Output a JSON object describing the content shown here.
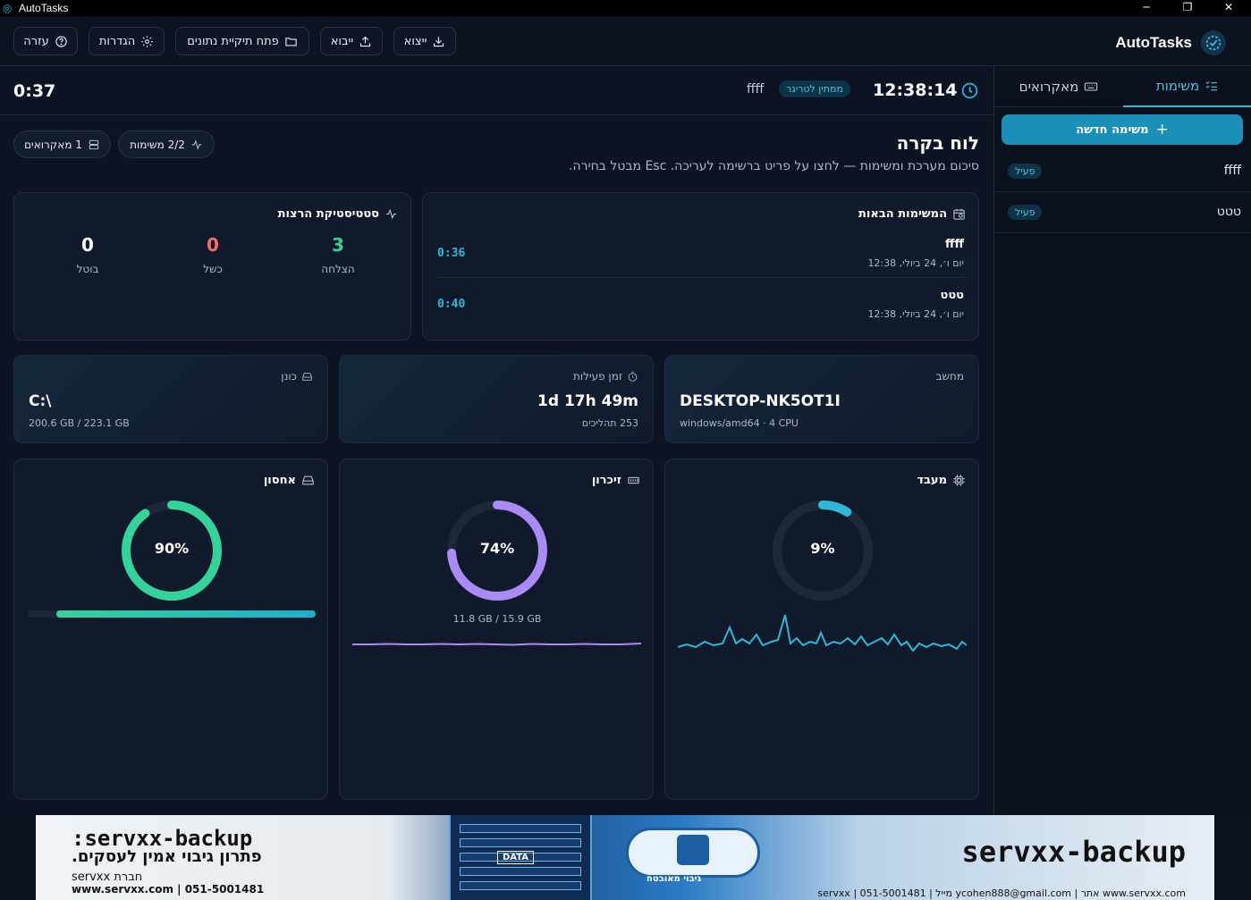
{
  "window": {
    "title": "AutoTasks",
    "minimize": "─",
    "maximize": "❐",
    "close": "✕"
  },
  "toolbar": {
    "help": "עזרה",
    "settings": "הגדרות",
    "open_folder": "פתח תיקיית נתונים",
    "import": "ייבוא",
    "export": "ייצוא",
    "brand": "AutoTasks"
  },
  "sidebar": {
    "tabs": [
      {
        "label": "משימות",
        "icon": "list-check-icon",
        "active": true
      },
      {
        "label": "מאקרואים",
        "icon": "keyboard-icon",
        "active": false
      }
    ],
    "new_task": "משימה חדשה",
    "tasks": [
      {
        "name": "ffff",
        "status": "פעיל"
      },
      {
        "name": "טטט",
        "status": "פעיל"
      }
    ]
  },
  "header": {
    "countdown": "0:37",
    "time": "12:38:14",
    "trigger_status": "ממתין לטריגר",
    "trigger_task": "ffff"
  },
  "dashboard": {
    "title": "לוח בקרה",
    "subtitle": "סיכום מערכת ומשימות — לחצו על פריט ברשימה לעריכה. Esc מבטל בחירה.",
    "pill_tasks": "2/2 משימות",
    "pill_macros": "1 מאקרואים"
  },
  "next_tasks": {
    "title": "המשימות הבאות",
    "items": [
      {
        "name": "ffff",
        "date": "יום ו׳, 24 ביולי, 12:38",
        "countdown": "0:36"
      },
      {
        "name": "טטט",
        "date": "יום ו׳, 24 ביולי, 12:38",
        "countdown": "0:40"
      }
    ]
  },
  "run_stats": {
    "title": "סטטיסטיקת הרצות",
    "success": {
      "label": "הצלחה",
      "value": "3",
      "color": "#34d39a"
    },
    "failed": {
      "label": "כשל",
      "value": "0",
      "color": "#f26d6d"
    },
    "cancelled": {
      "label": "בוטל",
      "value": "0",
      "color": "#ffffff"
    }
  },
  "info": {
    "computer": {
      "label": "מחשב",
      "value": "DESKTOP-NK5OT1I",
      "sub": "windows/amd64 · 4 CPU"
    },
    "uptime": {
      "label": "זמן פעילות",
      "value": "1d 17h 49m",
      "sub": "253 תהליכים"
    },
    "drive": {
      "label": "כונן",
      "value": "C:\\",
      "sub": "200.6 GB / 223.1 GB"
    }
  },
  "resources": {
    "cpu": {
      "label": "מעבד",
      "percent": 9,
      "pct_text": "9%",
      "color": "#2fb8d6"
    },
    "memory": {
      "label": "זיכרון",
      "percent": 74,
      "pct_text": "74%",
      "sub": "11.8 GB / 15.9 GB",
      "color": "#a98bf5"
    },
    "storage": {
      "label": "אחסון",
      "percent": 90,
      "pct_text": "90%",
      "color": "#34d39a",
      "bar_percent": 90
    }
  },
  "banner": {
    "brand_left": ":servxx-backup",
    "tagline": "פתרון גיבוי אמין לעסקים.",
    "company": "servxx חברת",
    "contact_left": "www.servxx.com | 051-5001481",
    "brand_right": "servxx-backup",
    "contact_right": "servxx | 051-5001481 | מייל ycohen888@gmail.com | אתר www.servxx.com",
    "server_label": "DATA",
    "secure_label": "גיבוי מאובטח"
  }
}
